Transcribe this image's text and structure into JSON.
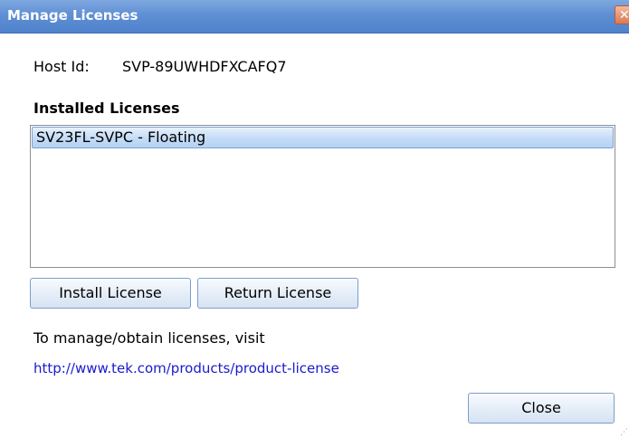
{
  "window": {
    "title": "Manage Licenses",
    "close_glyph": "✕"
  },
  "host": {
    "label": "Host Id:",
    "value": "SVP-89UWHDFXCAFQ7"
  },
  "licenses": {
    "title": "Installed Licenses",
    "items": [
      {
        "label": "SV23FL-SVPC - Floating",
        "selected": true
      }
    ]
  },
  "buttons": {
    "install": "Install License",
    "return": "Return License",
    "close": "Close"
  },
  "info": {
    "text": "To manage/obtain licenses, visit",
    "link": "http://www.tek.com/products/product-license"
  },
  "colors": {
    "titlebar": "#5f8fd4",
    "selection": "#c6ddf7",
    "link": "#1a1acc"
  }
}
